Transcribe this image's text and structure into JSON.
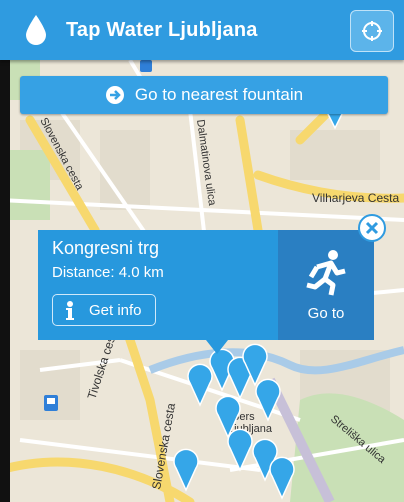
{
  "app": {
    "title": "Tap Water Ljubljana"
  },
  "toolbar": {
    "nearest_label": "Go to nearest fountain"
  },
  "info_window": {
    "place": "Kongresni trg",
    "distance": "Distance: 4.0 km",
    "get_info_label": "Get info",
    "goto_label": "Go to"
  },
  "map": {
    "street_labels": [
      "Vilharjeva Cesta",
      "Tivolska cesta",
      "Slovenska cesta",
      "Dalmatinova ulica",
      "Slovenska cesta",
      "Streliška ulica",
      "Ljubljana",
      "Bers"
    ]
  },
  "colors": {
    "accent": "#2f9be0",
    "info_bg": "#2798dd",
    "goto_bg": "#2a7fc2",
    "marker": "#35a6e8"
  },
  "icons": [
    "water-drop-icon",
    "locate-icon",
    "arrow-right-circle-icon",
    "info-icon",
    "running-man-icon",
    "close-icon",
    "map-marker-icon"
  ]
}
